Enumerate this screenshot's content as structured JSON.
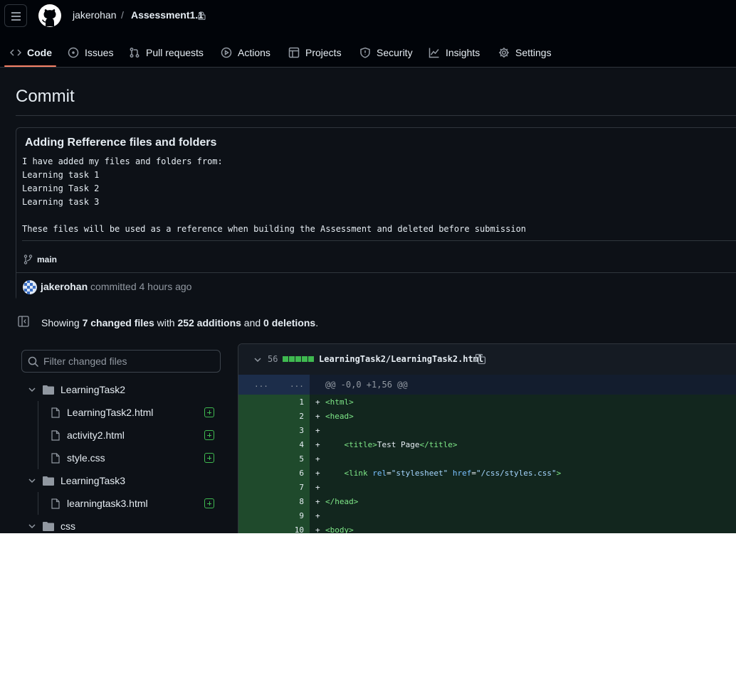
{
  "header": {
    "owner": "jakerohan",
    "separator": "/",
    "repo": "Assessment1.1",
    "tabs": [
      {
        "label": "Code",
        "icon": "code-icon"
      },
      {
        "label": "Issues",
        "icon": "issue-icon"
      },
      {
        "label": "Pull requests",
        "icon": "pull-request-icon"
      },
      {
        "label": "Actions",
        "icon": "play-icon"
      },
      {
        "label": "Projects",
        "icon": "table-icon"
      },
      {
        "label": "Security",
        "icon": "shield-icon"
      },
      {
        "label": "Insights",
        "icon": "graph-icon"
      },
      {
        "label": "Settings",
        "icon": "gear-icon"
      }
    ]
  },
  "page": {
    "title": "Commit"
  },
  "commit": {
    "title": "Adding Refference files and folders",
    "body": "I have added my files and folders from:\nLearning task 1\nLearning Task 2\nLearning task 3\n\nThese files will be used as a reference when building the Assessment and deleted before submission",
    "branch": "main",
    "author": "jakerohan",
    "action": "committed",
    "time": "4 hours ago"
  },
  "summary": {
    "prefix": "Showing",
    "changed": "7 changed files",
    "with": "with",
    "additions": "252 additions",
    "and": "and",
    "deletions": "0 deletions",
    "end": "."
  },
  "filetree": {
    "filter_placeholder": "Filter changed files",
    "items": [
      {
        "label": "LearningTask2",
        "type": "folder"
      },
      {
        "label": "LearningTask2.html",
        "type": "file",
        "status": "added"
      },
      {
        "label": "activity2.html",
        "type": "file",
        "status": "added"
      },
      {
        "label": "style.css",
        "type": "file",
        "status": "added"
      },
      {
        "label": "LearningTask3",
        "type": "folder"
      },
      {
        "label": "learningtask3.html",
        "type": "file",
        "status": "added"
      },
      {
        "label": "css",
        "type": "folder"
      }
    ]
  },
  "diff": {
    "count": "56",
    "path": "LearningTask2/LearningTask2.html",
    "hunk_left": "...",
    "hunk_right": "...",
    "hunk": "@@ -0,0 +1,56 @@",
    "lines": [
      {
        "num": "1",
        "sign": "+"
      },
      {
        "num": "2",
        "sign": "+"
      },
      {
        "num": "3",
        "sign": "+"
      },
      {
        "num": "4",
        "sign": "+"
      },
      {
        "num": "5",
        "sign": "+"
      },
      {
        "num": "6",
        "sign": "+"
      },
      {
        "num": "7",
        "sign": "+"
      },
      {
        "num": "8",
        "sign": "+"
      },
      {
        "num": "9",
        "sign": "+"
      },
      {
        "num": "10",
        "sign": "+"
      }
    ],
    "code": {
      "l1": "<html>",
      "l2": "<head>",
      "l4_indent": "    ",
      "l4_open": "<title>",
      "l4_text": "Test Page",
      "l4_close": "</title>",
      "l6_indent": "    ",
      "l6_tag": "<link",
      "l6_rel_attr": "rel",
      "l6_rel_val": "\"stylesheet\"",
      "l6_href_attr": "href",
      "l6_href_val": "\"/css/styles.css\"",
      "l6_end": ">",
      "l8": "</head>",
      "l10": "<body>"
    }
  },
  "colors": {
    "accent_underline": "#f78166",
    "added": "#3fb950",
    "background": "#0d1117"
  }
}
